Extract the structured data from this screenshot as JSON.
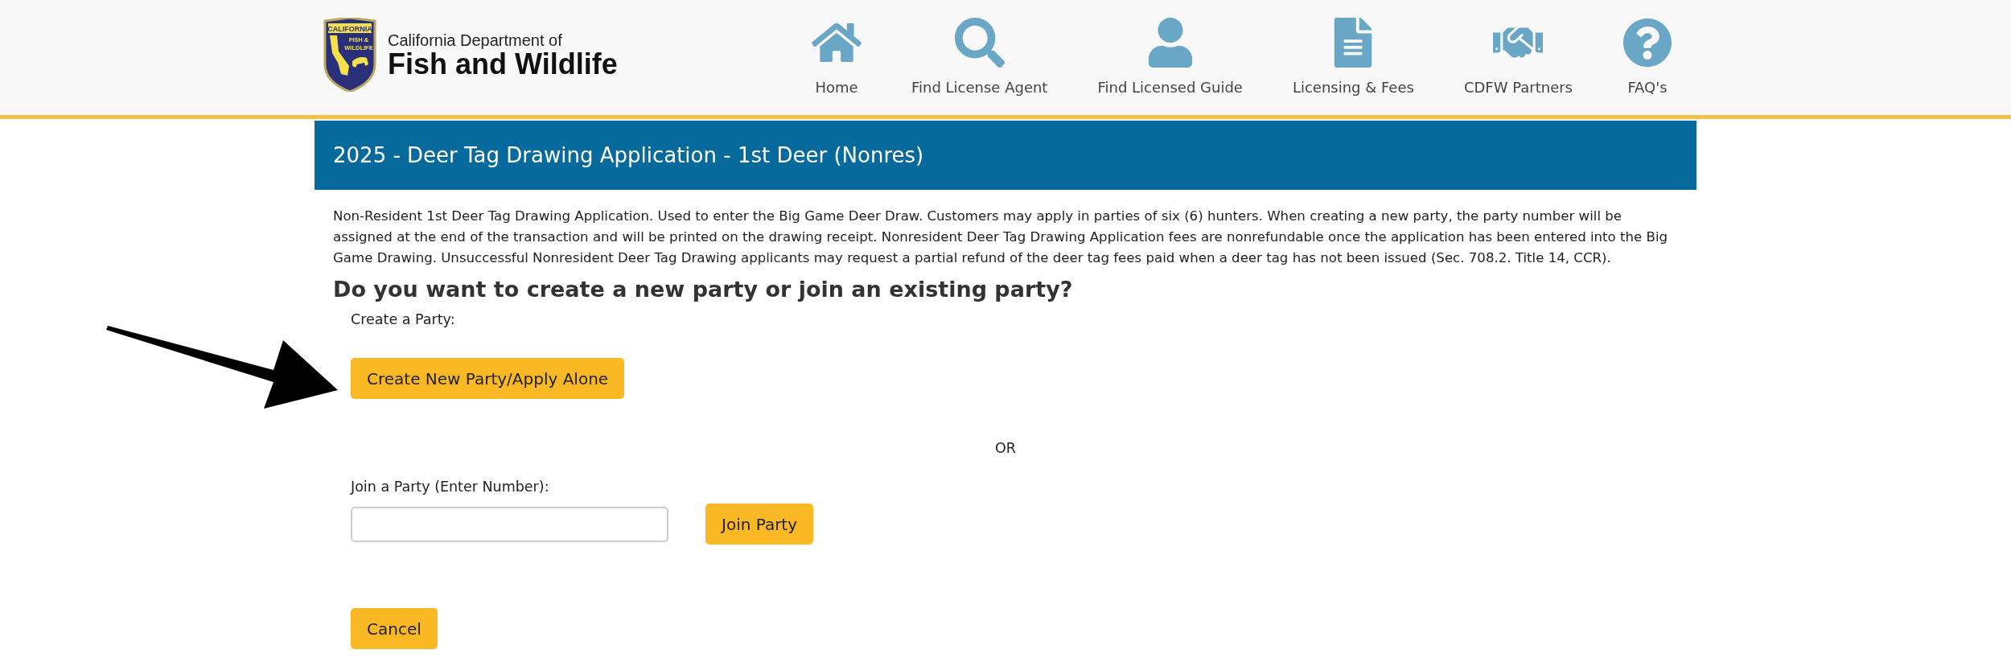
{
  "header": {
    "logo": {
      "badge_top": "CALIFORNIA",
      "badge_lines": [
        "FISH &",
        "WILDLIFE"
      ],
      "line_1": "California Department of",
      "line_2": "Fish and Wildlife"
    },
    "nav": [
      {
        "kind": "home",
        "label": "Home"
      },
      {
        "kind": "search",
        "label": "Find License Agent"
      },
      {
        "kind": "person",
        "label": "Find Licensed Guide"
      },
      {
        "kind": "document",
        "label": "Licensing & Fees"
      },
      {
        "kind": "handshake",
        "label": "CDFW Partners"
      },
      {
        "kind": "question",
        "label": "FAQ's"
      }
    ]
  },
  "page_title": "2025 - Deer Tag Drawing Application - 1st Deer (Nonres)",
  "description": "Non-Resident 1st Deer Tag Drawing Application. Used to enter the Big Game Deer Draw. Customers may apply in parties of six (6) hunters. When creating a new party, the party number will be assigned at the end of the transaction and will be printed on the drawing receipt. Nonresident Deer Tag Drawing Application fees are nonrefundable once the application has been entered into the Big Game Drawing. Unsuccessful Nonresident Deer Tag Drawing applicants may request a partial refund of the deer tag fees paid when a deer tag has not been issued (Sec. 708.2. Title 14, CCR).",
  "question": "Do you want to create a new party or join an existing party?",
  "create": {
    "label": "Create a Party:",
    "button": "Create New Party/Apply Alone"
  },
  "separator": "OR",
  "join": {
    "label": "Join a Party (Enter Number):",
    "button": "Join Party"
  },
  "cancel_button": "Cancel"
}
